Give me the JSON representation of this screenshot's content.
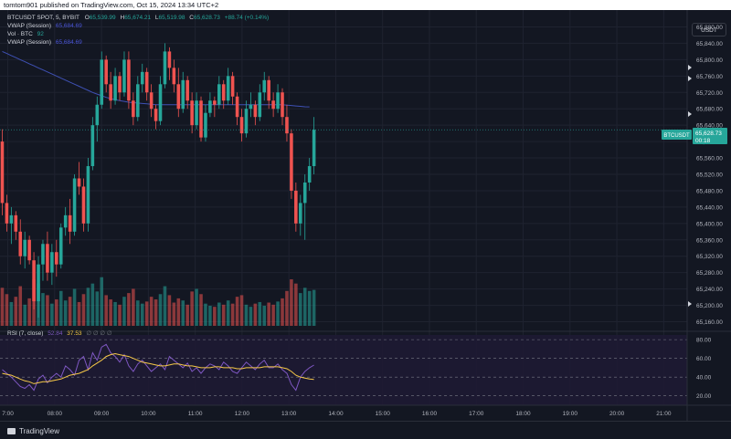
{
  "header": {
    "published_text": "tomtom901 published on TradingView.com, Oct 15, 2024 13:34 UTC+2"
  },
  "legend": {
    "symbol": "BTCUSDT SPOT, 5, BYBIT",
    "ohlc": [
      {
        "label": "O",
        "value": "65,539.99"
      },
      {
        "label": "H",
        "value": "65,674.21"
      },
      {
        "label": "L",
        "value": "65,519.98"
      },
      {
        "label": "C",
        "value": "65,628.73"
      }
    ],
    "change": "+88.74 (+0.14%)",
    "indicators": [
      {
        "name": "VWAP (Session)",
        "value": "65,684.69",
        "color": "#4a55d8"
      },
      {
        "name": "Vol · BTC",
        "value": "92",
        "color": "#26a69a"
      },
      {
        "name": "VWAP (Session)",
        "value": "65,684.69",
        "color": "#4a55d8"
      }
    ],
    "rsi": {
      "name": "RSI (7, close)",
      "value1": "52.84",
      "value2": "37.53",
      "icons": [
        "∅",
        "∅",
        "∅",
        "∅"
      ]
    }
  },
  "currency_button": "USDT",
  "price_tag": {
    "symbol": "BTCUSDT",
    "price": "65,628.73",
    "countdown": "00:18"
  },
  "footer": {
    "brand": "TradingView"
  },
  "colors": {
    "up": "#26a69a",
    "down": "#ef5350",
    "vwap": "#3f51b5",
    "rsi": "#7e57c2",
    "rsi_ma": "#f7c948"
  },
  "chart_data": {
    "type": "candlestick",
    "timeframe": "5",
    "x_ticks": [
      "7:00",
      "08:00",
      "09:00",
      "10:00",
      "11:00",
      "12:00",
      "13:00",
      "14:00",
      "15:00",
      "16:00",
      "17:00",
      "18:00",
      "19:00",
      "20:00",
      "21:00"
    ],
    "y_ticks": [
      "65,880.00",
      "65,840.00",
      "65,800.00",
      "65,760.00",
      "65,720.00",
      "65,680.00",
      "65,640.00",
      "65,600.00",
      "65,560.00",
      "65,520.00",
      "65,480.00",
      "65,440.00",
      "65,400.00",
      "65,360.00",
      "65,320.00",
      "65,280.00",
      "65,240.00",
      "65,200.00",
      "65,160.00"
    ],
    "ylim": [
      65150,
      65890
    ],
    "start_time": "06:50",
    "end_time": "21:30",
    "candles": [
      [
        65600,
        65630,
        65420,
        65450,
        72
      ],
      [
        65450,
        65470,
        65380,
        65400,
        60
      ],
      [
        65400,
        65440,
        65350,
        65420,
        45
      ],
      [
        65420,
        65430,
        65360,
        65380,
        55
      ],
      [
        65380,
        65410,
        65300,
        65320,
        75
      ],
      [
        65320,
        65380,
        65290,
        65360,
        40
      ],
      [
        65360,
        65370,
        65300,
        65310,
        52
      ],
      [
        65310,
        65330,
        65190,
        65210,
        88
      ],
      [
        65210,
        65320,
        65170,
        65300,
        80
      ],
      [
        65300,
        65360,
        65260,
        65350,
        62
      ],
      [
        65350,
        65380,
        65260,
        65280,
        58
      ],
      [
        65280,
        65350,
        65250,
        65330,
        42
      ],
      [
        65330,
        65360,
        65270,
        65300,
        50
      ],
      [
        65300,
        65400,
        65290,
        65390,
        66
      ],
      [
        65390,
        65440,
        65370,
        65420,
        48
      ],
      [
        65420,
        65460,
        65350,
        65380,
        55
      ],
      [
        65380,
        65520,
        65370,
        65510,
        70
      ],
      [
        65510,
        65550,
        65470,
        65490,
        45
      ],
      [
        65490,
        65510,
        65380,
        65400,
        60
      ],
      [
        65400,
        65560,
        65380,
        65540,
        72
      ],
      [
        65540,
        65660,
        65530,
        65640,
        80
      ],
      [
        65640,
        65710,
        65600,
        65690,
        65
      ],
      [
        65690,
        65820,
        65680,
        65800,
        92
      ],
      [
        65800,
        65810,
        65720,
        65740,
        58
      ],
      [
        65740,
        65770,
        65680,
        65700,
        50
      ],
      [
        65700,
        65780,
        65690,
        65760,
        45
      ],
      [
        65760,
        65770,
        65700,
        65720,
        40
      ],
      [
        65720,
        65820,
        65710,
        65800,
        55
      ],
      [
        65800,
        65820,
        65680,
        65700,
        62
      ],
      [
        65700,
        65720,
        65640,
        65660,
        70
      ],
      [
        65660,
        65760,
        65650,
        65740,
        48
      ],
      [
        65740,
        65790,
        65720,
        65770,
        42
      ],
      [
        65770,
        65780,
        65700,
        65720,
        46
      ],
      [
        65720,
        65740,
        65660,
        65680,
        55
      ],
      [
        65680,
        65690,
        65630,
        65650,
        50
      ],
      [
        65650,
        65760,
        65640,
        65740,
        60
      ],
      [
        65740,
        65840,
        65730,
        65820,
        75
      ],
      [
        65820,
        65830,
        65750,
        65780,
        58
      ],
      [
        65780,
        65800,
        65720,
        65740,
        44
      ],
      [
        65740,
        65780,
        65660,
        65680,
        52
      ],
      [
        65680,
        65770,
        65670,
        65750,
        48
      ],
      [
        65750,
        65760,
        65680,
        65700,
        40
      ],
      [
        65700,
        65720,
        65620,
        65640,
        65
      ],
      [
        65640,
        65720,
        65630,
        65700,
        70
      ],
      [
        65700,
        65710,
        65600,
        65610,
        60
      ],
      [
        65610,
        65690,
        65600,
        65670,
        42
      ],
      [
        65670,
        65720,
        65660,
        65700,
        38
      ],
      [
        65700,
        65710,
        65660,
        65690,
        36
      ],
      [
        65690,
        65760,
        65680,
        65740,
        44
      ],
      [
        65740,
        65750,
        65680,
        65700,
        40
      ],
      [
        65700,
        65780,
        65690,
        65760,
        48
      ],
      [
        65760,
        65770,
        65690,
        65710,
        42
      ],
      [
        65710,
        65720,
        65640,
        65660,
        55
      ],
      [
        65660,
        65680,
        65600,
        65620,
        58
      ],
      [
        65620,
        65700,
        65610,
        65680,
        40
      ],
      [
        65680,
        65720,
        65660,
        65690,
        36
      ],
      [
        65690,
        65700,
        65640,
        65660,
        42
      ],
      [
        65660,
        65740,
        65650,
        65720,
        45
      ],
      [
        65720,
        65770,
        65700,
        65750,
        38
      ],
      [
        65750,
        65760,
        65680,
        65700,
        44
      ],
      [
        65700,
        65720,
        65660,
        65680,
        40
      ],
      [
        65680,
        65740,
        65670,
        65720,
        46
      ],
      [
        65720,
        65730,
        65640,
        65660,
        52
      ],
      [
        65660,
        65690,
        65600,
        65620,
        66
      ],
      [
        65620,
        65630,
        65460,
        65480,
        88
      ],
      [
        65480,
        65500,
        65380,
        65400,
        80
      ],
      [
        65400,
        65470,
        65370,
        65450,
        62
      ],
      [
        65450,
        65520,
        65360,
        65500,
        72
      ],
      [
        65500,
        65560,
        65480,
        65540,
        66
      ],
      [
        65540,
        65660,
        65520,
        65628.73,
        68
      ]
    ],
    "vwap": [
      65820,
      65815,
      65810,
      65805,
      65800,
      65795,
      65790,
      65785,
      65780,
      65775,
      65770,
      65765,
      65760,
      65755,
      65750,
      65745,
      65740,
      65735,
      65730,
      65725,
      65720,
      65716,
      65712,
      65708,
      65705,
      65702,
      65700,
      65698,
      65696,
      65695,
      65694,
      65693,
      65692,
      65691,
      65690,
      65690,
      65690,
      65690,
      65690,
      65690,
      65690,
      65690,
      65690,
      65690,
      65690,
      65690,
      65690,
      65690,
      65690,
      65690,
      65690,
      65690,
      65690,
      65690,
      65690,
      65690,
      65690,
      65690,
      65690,
      65690,
      65690,
      65690,
      65690,
      65689,
      65688,
      65687,
      65686,
      65685,
      65684.69
    ],
    "rsi": {
      "ylim": [
        10,
        85
      ],
      "levels": [
        20,
        40,
        60,
        80
      ],
      "values": [
        48,
        44,
        40,
        35,
        30,
        28,
        32,
        26,
        38,
        42,
        34,
        40,
        44,
        40,
        52,
        48,
        42,
        58,
        62,
        48,
        66,
        58,
        72,
        75,
        66,
        62,
        56,
        64,
        52,
        46,
        54,
        58,
        52,
        46,
        50,
        54,
        48,
        62,
        58,
        54,
        50,
        55,
        46,
        50,
        44,
        50,
        54,
        52,
        48,
        56,
        52,
        46,
        44,
        50,
        56,
        52,
        48,
        54,
        58,
        50,
        50,
        54,
        48,
        44,
        32,
        26,
        40,
        46,
        50,
        52.84
      ],
      "ma": [
        44,
        43,
        42,
        40,
        38,
        36,
        35,
        33,
        34,
        35,
        35,
        36,
        37,
        38,
        40,
        42,
        43,
        44,
        46,
        48,
        52,
        55,
        58,
        62,
        64,
        65,
        64,
        63,
        62,
        60,
        58,
        56,
        55,
        54,
        53,
        52,
        52,
        53,
        54,
        54,
        53,
        52,
        52,
        51,
        50,
        50,
        50,
        51,
        51,
        50,
        50,
        50,
        49,
        49,
        50,
        50,
        50,
        50,
        51,
        51,
        51,
        51,
        50,
        49,
        46,
        42,
        40,
        39,
        38,
        37.53
      ]
    }
  }
}
